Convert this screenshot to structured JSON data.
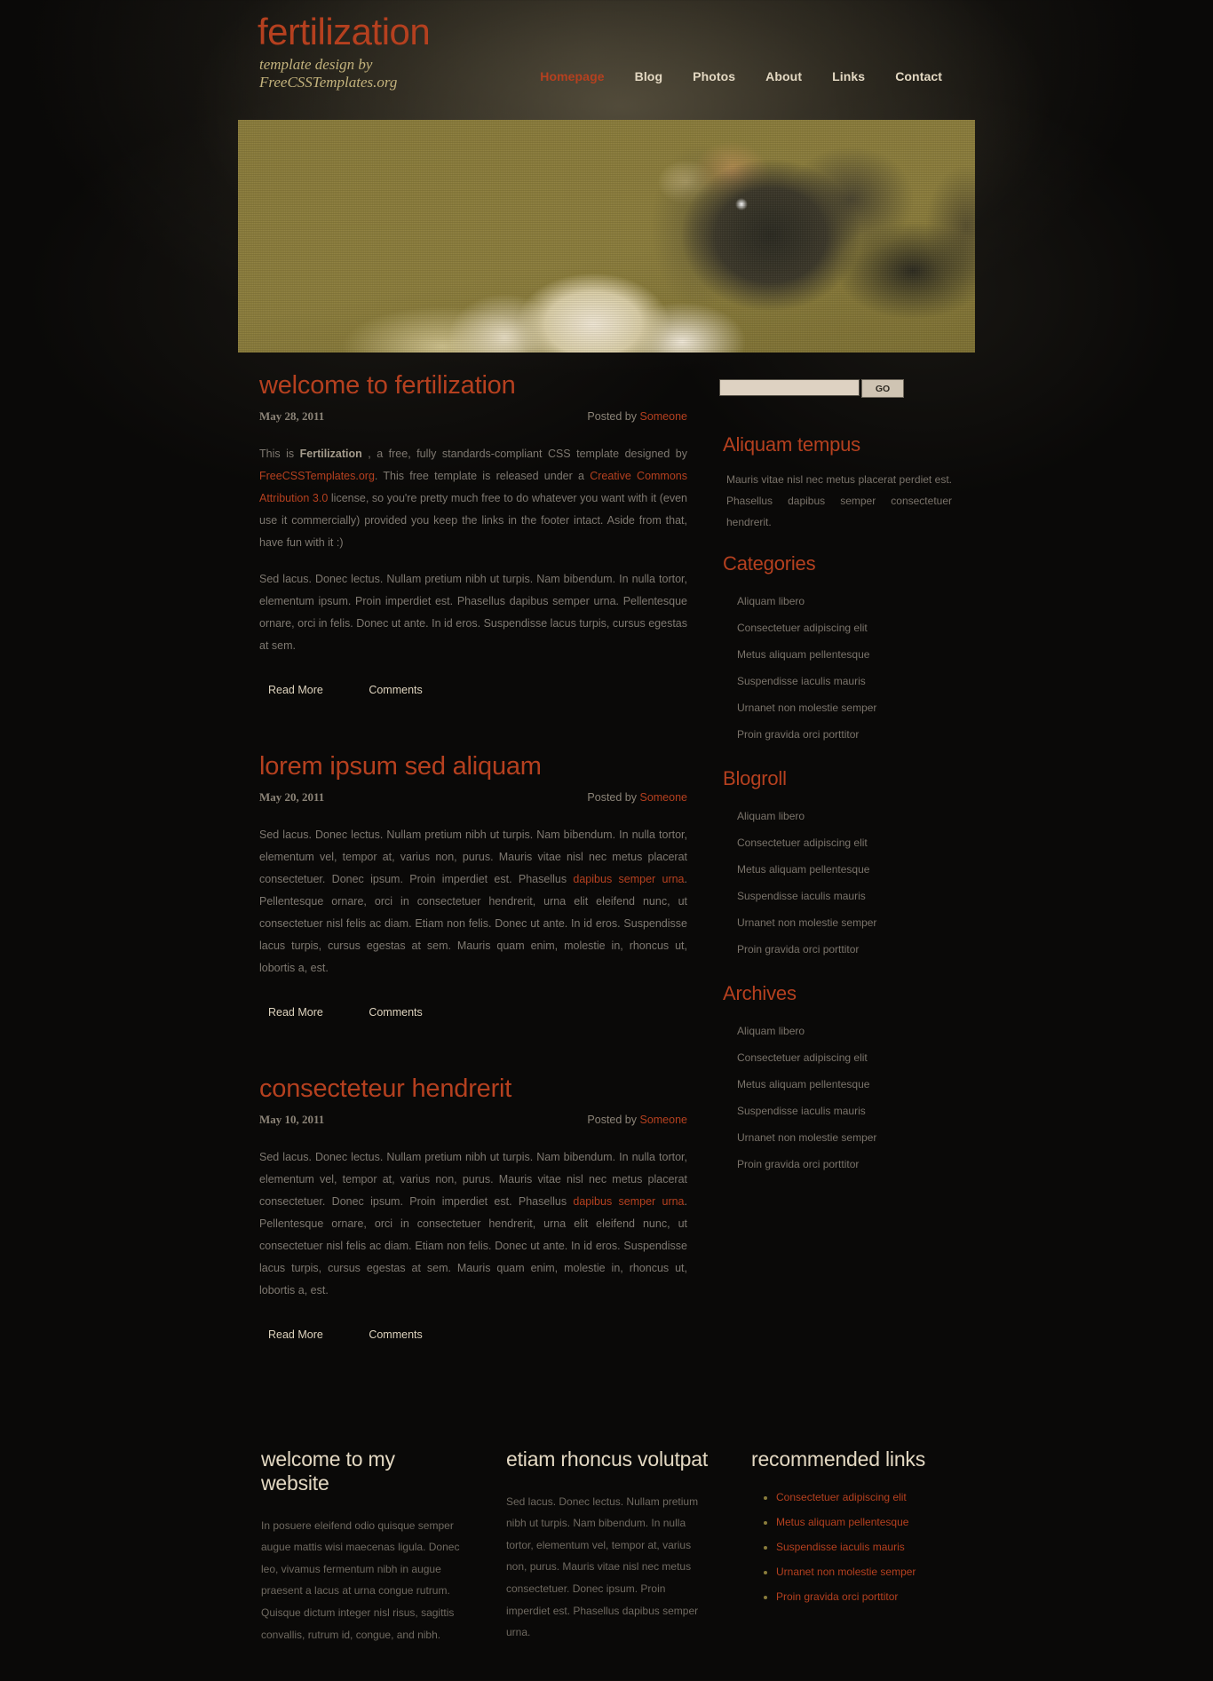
{
  "site": {
    "title": "fertilization",
    "tagline_line1": "template design by",
    "tagline_line2": "FreeCSSTemplates.org",
    "accent_color": "#b5401f",
    "banner_color": "#8a7c3b",
    "background_color": "#0a0908"
  },
  "menu": {
    "items": [
      {
        "label": "Homepage",
        "active": true
      },
      {
        "label": "Blog",
        "active": false
      },
      {
        "label": "Photos",
        "active": false
      },
      {
        "label": "About",
        "active": false
      },
      {
        "label": "Links",
        "active": false
      },
      {
        "label": "Contact",
        "active": false
      }
    ]
  },
  "banner": {
    "alt": "close-up macro photograph of a honey bee on pale flowers, sepia toned"
  },
  "posts": [
    {
      "title": "welcome to fertilization",
      "date": "May 28, 2011",
      "posted_by_label": "Posted by",
      "author": "Someone",
      "paragraphs": [
        "This is Fertilization , a free, fully standards-compliant CSS template designed by FreeCSSTemplates.org. This free template is released under a Creative Commons Attribution 3.0 license, so you're pretty much free to do whatever you want with it (even use it commercially) provided you keep the links in the footer intact. Aside from that, have fun with it :)",
        "Sed lacus. Donec lectus. Nullam pretium nibh ut turpis. Nam bibendum. In nulla tortor, elementum ipsum. Proin imperdiet est. Phasellus dapibus semper urna. Pellentesque ornare, orci in felis. Donec ut ante. In id eros. Suspendisse lacus turpis, cursus egestas at sem."
      ],
      "read_more": "Read More",
      "comments": "Comments"
    },
    {
      "title": "lorem ipsum sed aliquam",
      "date": "May 20, 2011",
      "posted_by_label": "Posted by",
      "author": "Someone",
      "paragraphs": [
        "Sed lacus. Donec lectus. Nullam pretium nibh ut turpis. Nam bibendum. In nulla tortor, elementum vel, tempor at, varius non, purus. Mauris vitae nisl nec metus placerat consectetuer. Donec ipsum. Proin imperdiet est. Phasellus dapibus semper urna. Pellentesque ornare, orci in consectetuer hendrerit, urna elit eleifend nunc, ut consectetuer nisl felis ac diam. Etiam non felis. Donec ut ante. In id eros. Suspendisse lacus turpis, cursus egestas at sem. Mauris quam enim, molestie in, rhoncus ut, lobortis a, est."
      ],
      "read_more": "Read More",
      "comments": "Comments"
    },
    {
      "title": "consecteteur hendrerit",
      "date": "May 10, 2011",
      "posted_by_label": "Posted by",
      "author": "Someone",
      "paragraphs": [
        "Sed lacus. Donec lectus. Nullam pretium nibh ut turpis. Nam bibendum. In nulla tortor, elementum vel, tempor at, varius non, purus. Mauris vitae nisl nec metus placerat consectetuer. Donec ipsum. Proin imperdiet est. Phasellus dapibus semper urna. Pellentesque ornare, orci in consectetuer hendrerit, urna elit eleifend nunc, ut consectetuer nisl felis ac diam. Etiam non felis. Donec ut ante. In id eros. Suspendisse lacus turpis, cursus egestas at sem. Mauris quam enim, molestie in, rhoncus ut, lobortis a, est."
      ],
      "read_more": "Read More",
      "comments": "Comments"
    }
  ],
  "sidebar": {
    "search": {
      "value": "",
      "placeholder": "",
      "button_label": "GO"
    },
    "boxes": [
      {
        "heading": "Aliquam tempus",
        "text": "Mauris vitae nisl nec metus placerat perdiet est. Phasellus dapibus semper consectetuer hendrerit.",
        "items": []
      },
      {
        "heading": "Categories",
        "text": "",
        "items": [
          "Aliquam libero",
          "Consectetuer adipiscing elit",
          "Metus aliquam pellentesque",
          "Suspendisse iaculis mauris",
          "Urnanet non molestie semper",
          "Proin gravida orci porttitor"
        ]
      },
      {
        "heading": "Blogroll",
        "text": "",
        "items": [
          "Aliquam libero",
          "Consectetuer adipiscing elit",
          "Metus aliquam pellentesque",
          "Suspendisse iaculis mauris",
          "Urnanet non molestie semper",
          "Proin gravida orci porttitor"
        ]
      },
      {
        "heading": "Archives",
        "text": "",
        "items": [
          "Aliquam libero",
          "Consectetuer adipiscing elit",
          "Metus aliquam pellentesque",
          "Suspendisse iaculis mauris",
          "Urnanet non molestie semper",
          "Proin gravida orci porttitor"
        ]
      }
    ]
  },
  "footer": {
    "columns": [
      {
        "heading": "welcome to my website",
        "text": "In posuere eleifend odio quisque semper augue mattis wisi maecenas ligula. Donec leo, vivamus fermentum nibh in augue praesent a lacus at urna congue rutrum. Quisque dictum integer nisl risus, sagittis convallis, rutrum id, congue, and nibh.",
        "items": []
      },
      {
        "heading": "etiam rhoncus volutpat",
        "text": "Sed lacus. Donec lectus. Nullam pretium nibh ut turpis. Nam bibendum. In nulla tortor, elementum vel, tempor at, varius non, purus. Mauris vitae nisl nec metus consectetuer. Donec ipsum. Proin imperdiet est. Phasellus dapibus semper urna.",
        "items": []
      },
      {
        "heading": "recommended links",
        "text": "",
        "items": [
          "Consectetuer adipiscing elit",
          "Metus aliquam pellentesque",
          "Suspendisse iaculis mauris",
          "Urnanet non molestie semper",
          "Proin gravida orci porttitor"
        ]
      }
    ]
  }
}
